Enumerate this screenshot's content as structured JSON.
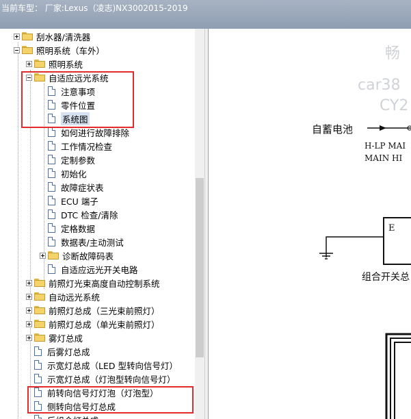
{
  "window": {
    "title": "当前车型： 厂家:Lexus（凌志)NX3002015-2019"
  },
  "tree": [
    {
      "label": "刮水器/清洗器",
      "indent": 1,
      "type": "folder",
      "toggle": "plus"
    },
    {
      "label": "照明系统（车外）",
      "indent": 1,
      "type": "folder",
      "toggle": "minus"
    },
    {
      "label": "照明系统",
      "indent": 2,
      "type": "folder",
      "toggle": "plus"
    },
    {
      "label": "自适应远光系统",
      "indent": 2,
      "type": "folder",
      "toggle": "minus"
    },
    {
      "label": "注意事项",
      "indent": 3,
      "type": "page"
    },
    {
      "label": "零件位置",
      "indent": 3,
      "type": "page"
    },
    {
      "label": "系统图",
      "indent": 3,
      "type": "page",
      "selected": true
    },
    {
      "label": "如何进行故障排除",
      "indent": 3,
      "type": "page"
    },
    {
      "label": "工作情况检查",
      "indent": 3,
      "type": "page"
    },
    {
      "label": "定制参数",
      "indent": 3,
      "type": "page"
    },
    {
      "label": "初始化",
      "indent": 3,
      "type": "page"
    },
    {
      "label": "故障症状表",
      "indent": 3,
      "type": "page"
    },
    {
      "label": "ECU 端子",
      "indent": 3,
      "type": "page"
    },
    {
      "label": "DTC 检查/清除",
      "indent": 3,
      "type": "page"
    },
    {
      "label": "定格数据",
      "indent": 3,
      "type": "page"
    },
    {
      "label": "数据表/主动测试",
      "indent": 3,
      "type": "page"
    },
    {
      "label": "诊断故障码表",
      "indent": 3,
      "type": "folder",
      "toggle": "plus"
    },
    {
      "label": "自适应远光开关电路",
      "indent": 3,
      "type": "page"
    },
    {
      "label": "前照灯光束高度自动控制系统",
      "indent": 2,
      "type": "folder",
      "toggle": "plus"
    },
    {
      "label": "自动远光系统",
      "indent": 2,
      "type": "folder",
      "toggle": "plus"
    },
    {
      "label": "前照灯总成（三光束前照灯）",
      "indent": 2,
      "type": "folder",
      "toggle": "plus"
    },
    {
      "label": "前照灯总成（单光束前照灯）",
      "indent": 2,
      "type": "folder",
      "toggle": "plus"
    },
    {
      "label": "雾灯总成",
      "indent": 2,
      "type": "folder",
      "toggle": "plus"
    },
    {
      "label": "后雾灯总成",
      "indent": 2,
      "type": "page"
    },
    {
      "label": "示宽灯总成（LED 型转向信号灯）",
      "indent": 2,
      "type": "page"
    },
    {
      "label": "示宽灯总成（灯泡型转向信号灯）",
      "indent": 2,
      "type": "page"
    },
    {
      "label": "前转向信号灯灯泡（灯泡型）",
      "indent": 2,
      "type": "page"
    },
    {
      "label": "侧转向信号灯总成",
      "indent": 2,
      "type": "page"
    },
    {
      "label": "后组合灯总成",
      "indent": 2,
      "type": "page"
    }
  ],
  "document": {
    "watermark": [
      "畅",
      "car38",
      "CY2"
    ],
    "label_battery": "自蓄电池",
    "signal_1": "H-LP MAI",
    "signal_2": "MAIN HI",
    "connector": "E",
    "switch_label": "组合开关总"
  },
  "colors": {
    "highlight_box": "#e22b2b",
    "selection": "#d6e1ef",
    "titlebar": "#98a6b9"
  }
}
